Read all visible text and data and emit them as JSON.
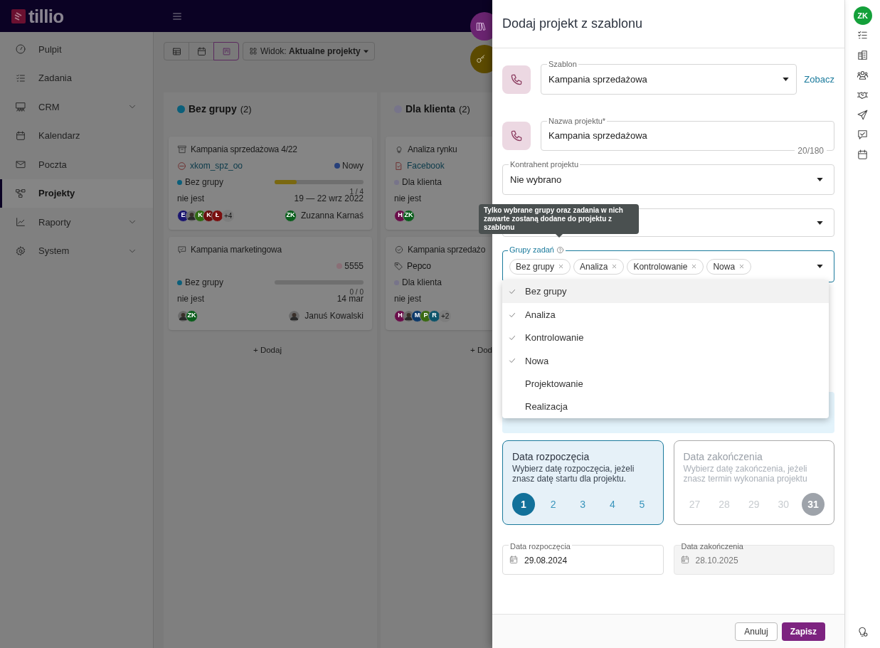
{
  "app": {
    "logo": "tillio"
  },
  "sidebar": {
    "items": [
      {
        "label": "Pulpit",
        "selected": false,
        "expandable": false
      },
      {
        "label": "Zadania",
        "selected": false,
        "expandable": false
      },
      {
        "label": "CRM",
        "selected": false,
        "expandable": true
      },
      {
        "label": "Kalendarz",
        "selected": false,
        "expandable": false
      },
      {
        "label": "Poczta",
        "selected": false,
        "expandable": false
      },
      {
        "label": "Projekty",
        "selected": true,
        "expandable": false
      },
      {
        "label": "Raporty",
        "selected": false,
        "expandable": true
      },
      {
        "label": "System",
        "selected": false,
        "expandable": true
      }
    ]
  },
  "toolbar": {
    "views": [
      {
        "selected": false
      },
      {
        "selected": false
      },
      {
        "selected": true
      }
    ],
    "view_select": "Widok: **Aktualne projekty**"
  },
  "board": {
    "columns": [
      {
        "name": "Bez grupy",
        "count": "(2)",
        "color": "#0b5f7a",
        "add": "+ Dodaj",
        "cards": [
          {
            "title": "Kampania sprzedażowa 4/22",
            "client": "xkom_spz_oo",
            "status": {
              "label": "Nowy",
              "color": "#27407a"
            },
            "group": {
              "label": "Bez grupy",
              "color": "#0b5f7a"
            },
            "level": 0.25,
            "progress": "1 / 4",
            "field": "nie jest",
            "dates": "19 — 22 wrz 2022",
            "avatars": [
              {
                "kind": "letter",
                "text": "E",
                "color": "#1a1570"
              },
              {
                "kind": "photo"
              },
              {
                "kind": "letter",
                "text": "K",
                "color": "#2f6a12"
              },
              {
                "kind": "letter",
                "text": "K",
                "color": "#6a0d0d"
              },
              {
                "kind": "letter",
                "text": "Ł",
                "color": "#7a0f0f"
              }
            ],
            "more": "+4",
            "owner": {
              "kind": "letter",
              "text": "ZK",
              "color": "#0a5e1c",
              "name": "Zuzanna Karnaś"
            }
          },
          {
            "title": "Kampania marketingowa",
            "status": {
              "label": "5555",
              "color": "#8a6f76"
            },
            "group": {
              "label": "Bez grupy",
              "color": "#0b5f7a"
            },
            "level": 0,
            "progress": "0 / 0",
            "field": "nie jest",
            "dates": "14 mar",
            "avatars": [
              {
                "kind": "photo"
              },
              {
                "kind": "letter",
                "text": "ZK",
                "color": "#0a5e1c"
              }
            ],
            "owner": {
              "kind": "photo",
              "name": "Januś Kowalski"
            }
          }
        ]
      },
      {
        "name": "Dla klienta",
        "count": "(2)",
        "color": "#77748a",
        "add": "+ Dod",
        "cards": [
          {
            "title": "Analiza rynku",
            "client": "Facebook",
            "group": {
              "label": "Dla klienta",
              "color": "#77748a"
            },
            "field": "nie jest",
            "avatars": [
              {
                "kind": "letter",
                "text": "H",
                "color": "#6a0d4a"
              },
              {
                "kind": "letter",
                "text": "ZK",
                "color": "#0a5e1c"
              }
            ]
          },
          {
            "title": "Kampania sprzedażo",
            "client": "Pepco",
            "group": {
              "label": "Dla klienta",
              "color": "#77748a"
            },
            "field": "nie jest",
            "avatars": [
              {
                "kind": "letter",
                "text": "H",
                "color": "#6a0d4a"
              },
              {
                "kind": "photo"
              },
              {
                "kind": "letter",
                "text": "M",
                "color": "#0d3a6a"
              },
              {
                "kind": "letter",
                "text": "P",
                "color": "#3a6a12"
              },
              {
                "kind": "letter",
                "text": "R",
                "color": "#0d546a"
              }
            ],
            "more": "+2"
          }
        ]
      }
    ]
  },
  "drawer": {
    "title": "Dodaj projekt z szablonu",
    "template": {
      "label": "Szablon",
      "value": "Kampania sprzedażowa",
      "link": "Zobacz"
    },
    "name": {
      "label": "Nazwa projektu*",
      "value": "Kampania sprzedażowa",
      "counter": "20/180"
    },
    "contractor": {
      "label": "Kontrahent projektu",
      "value": "Nie wybrano"
    },
    "task_groups": {
      "label": "Grupy zadań",
      "chips": [
        "Bez grupy",
        "Analiza",
        "Kontrolowanie",
        "Nowa"
      ],
      "tooltip": "Tylko wybrane grupy oraz zadania w nich zawarte zostaną dodane do projektu z szablonu",
      "options": [
        {
          "label": "Bez grupy",
          "checked": true
        },
        {
          "label": "Analiza",
          "checked": true
        },
        {
          "label": "Kontrolowanie",
          "checked": true
        },
        {
          "label": "Nowa",
          "checked": true
        },
        {
          "label": "Projektowanie",
          "checked": false
        },
        {
          "label": "Realizacja",
          "checked": false
        }
      ]
    },
    "date_modes": [
      {
        "title": "Data rozpoczęcia",
        "text": "Wybierz datę rozpoczęcia, jeżeli znasz datę startu dla projektu.",
        "selected": true,
        "days": [
          {
            "label": "1",
            "selected": true
          },
          {
            "label": "2",
            "selected": false
          },
          {
            "label": "3",
            "selected": false
          },
          {
            "label": "4",
            "selected": false
          },
          {
            "label": "5",
            "selected": false
          }
        ]
      },
      {
        "title": "Data zakończenia",
        "text": "Wybierz datę zakończenia, jeżeli znasz termin wykonania projektu",
        "selected": false,
        "days": [
          {
            "label": "27",
            "selected": false
          },
          {
            "label": "28",
            "selected": false
          },
          {
            "label": "29",
            "selected": false
          },
          {
            "label": "30",
            "selected": false
          },
          {
            "label": "31",
            "selected": true
          }
        ]
      }
    ],
    "dates": [
      {
        "label": "Data rozpoczęcia",
        "value": "29.08.2024",
        "disabled": false
      },
      {
        "label": "Data zakończenia",
        "value": "28.10.2025",
        "disabled": true
      }
    ],
    "buttons": [
      {
        "label": "Anuluj",
        "kind": "secondary"
      },
      {
        "label": "Zapisz",
        "kind": "primary"
      }
    ]
  },
  "rail": {
    "user": "ZK"
  }
}
